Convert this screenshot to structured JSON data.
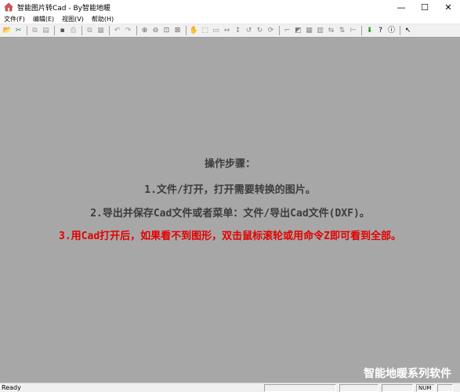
{
  "window": {
    "title": "智能图片转Cad - By智能地暖",
    "controls": {
      "minimize": "—",
      "maximize": "☐",
      "close": "✕"
    }
  },
  "menu": [
    "文件(F)",
    "编辑(E)",
    "视图(V)",
    "帮助(H)"
  ],
  "toolbar": {
    "groups": [
      [
        {
          "name": "open-icon",
          "glyph": "📂",
          "color": "#c9a227"
        },
        {
          "name": "cut-icon",
          "glyph": "✂",
          "color": "#3a7d3a"
        }
      ],
      [
        {
          "name": "copy-icon",
          "glyph": "⧉",
          "color": "#999999"
        },
        {
          "name": "paste-icon",
          "glyph": "▤",
          "color": "#999999"
        }
      ],
      [
        {
          "name": "save-icon",
          "glyph": "▪",
          "color": "#555555"
        },
        {
          "name": "print-icon",
          "glyph": "⎙",
          "color": "#999999"
        }
      ],
      [
        {
          "name": "duplicate-icon",
          "glyph": "⧉",
          "color": "#999999"
        },
        {
          "name": "layers-icon",
          "glyph": "▦",
          "color": "#999999"
        }
      ],
      [
        {
          "name": "undo-icon",
          "glyph": "↶",
          "color": "#999999"
        },
        {
          "name": "redo-icon",
          "glyph": "↷",
          "color": "#999999"
        }
      ],
      [
        {
          "name": "zoom-in-icon",
          "glyph": "⊕",
          "color": "#666666"
        },
        {
          "name": "zoom-out-icon",
          "glyph": "⊖",
          "color": "#666666"
        },
        {
          "name": "zoom-window-icon",
          "glyph": "⊡",
          "color": "#666666"
        },
        {
          "name": "zoom-extents-icon",
          "glyph": "⊠",
          "color": "#666666"
        }
      ],
      [
        {
          "name": "pan-icon",
          "glyph": "✋",
          "color": "#888888"
        },
        {
          "name": "select-rect-icon",
          "glyph": "⬚",
          "color": "#888888"
        },
        {
          "name": "select-window-icon",
          "glyph": "▭",
          "color": "#888888"
        },
        {
          "name": "move-horizontal-icon",
          "glyph": "↔",
          "color": "#888888"
        },
        {
          "name": "move-vertical-icon",
          "glyph": "↕",
          "color": "#888888"
        },
        {
          "name": "rotate-left-icon",
          "glyph": "↺",
          "color": "#888888"
        },
        {
          "name": "rotate-right-icon",
          "glyph": "↻",
          "color": "#888888"
        },
        {
          "name": "refresh-icon",
          "glyph": "⟳",
          "color": "#888888"
        }
      ],
      [
        {
          "name": "crop-icon",
          "glyph": "⌐",
          "color": "#888888"
        },
        {
          "name": "fill-icon",
          "glyph": "◩",
          "color": "#777777"
        },
        {
          "name": "grid-icon",
          "glyph": "▦",
          "color": "#888888"
        },
        {
          "name": "align-icon",
          "glyph": "▥",
          "color": "#888888"
        },
        {
          "name": "mirror-icon",
          "glyph": "⇆",
          "color": "#888888"
        },
        {
          "name": "flip-icon",
          "glyph": "⇅",
          "color": "#888888"
        },
        {
          "name": "measure-icon",
          "glyph": "⊢",
          "color": "#888888"
        }
      ],
      [
        {
          "name": "download-icon",
          "glyph": "⬇",
          "color": "#1a8f1a"
        },
        {
          "name": "help-icon",
          "glyph": "?",
          "color": "#000000"
        },
        {
          "name": "info-icon",
          "glyph": "ⓘ",
          "color": "#000000"
        }
      ],
      [
        {
          "name": "context-help-icon",
          "glyph": "↖",
          "color": "#000000"
        }
      ]
    ]
  },
  "canvas": {
    "background": "#a7a7a7",
    "instructions": [
      {
        "text": "操作步骤：",
        "color": "#3c3c3c"
      },
      {
        "text": "1.文件/打开，打开需要转换的图片。",
        "color": "#3c3c3c"
      },
      {
        "text": "2.导出并保存Cad文件或者菜单：文件/导出Cad文件(DXF)。",
        "color": "#3c3c3c"
      },
      {
        "text": "3.用Cad打开后，如果看不到图形，双击鼠标滚轮或用命令Z即可看到全部。",
        "color": "#e50000"
      }
    ],
    "brand": "智能地暖系列软件"
  },
  "status": {
    "text": "Ready",
    "indicators": [
      "NUM"
    ]
  }
}
